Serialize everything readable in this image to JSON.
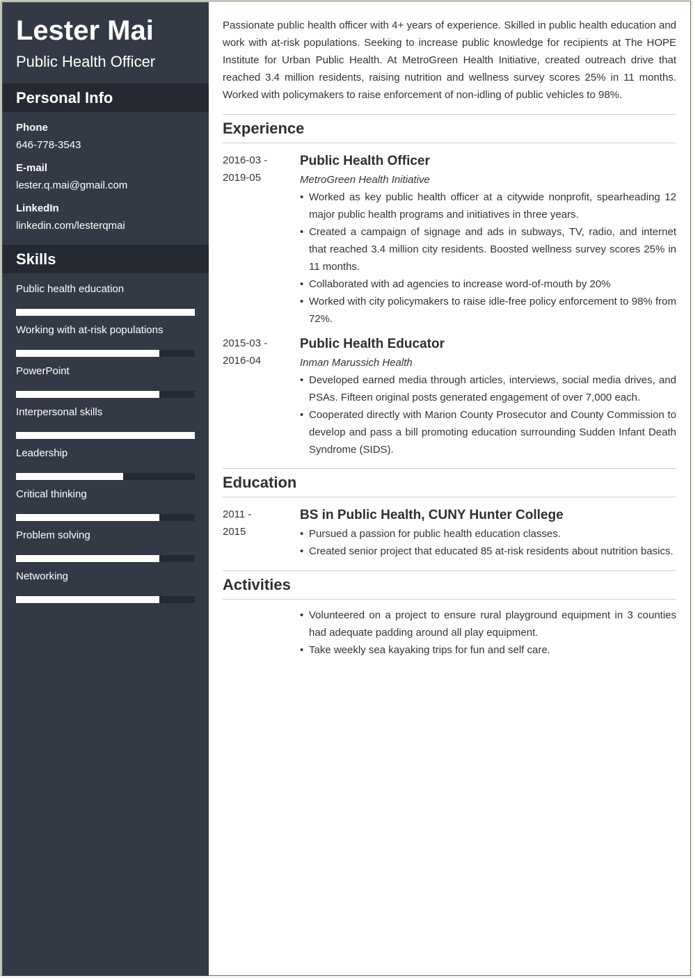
{
  "sidebar": {
    "name": "Lester Mai",
    "title": "Public Health Officer",
    "personal_heading": "Personal Info",
    "contacts": [
      {
        "label": "Phone",
        "value": "646-778-3543"
      },
      {
        "label": "E-mail",
        "value": "lester.q.mai@gmail.com"
      },
      {
        "label": "LinkedIn",
        "value": "linkedin.com/lesterqmai"
      }
    ],
    "skills_heading": "Skills",
    "skills": [
      {
        "name": "Public health education",
        "level": 1.0
      },
      {
        "name": "Working with at-risk populations",
        "level": 0.8
      },
      {
        "name": "PowerPoint",
        "level": 0.8
      },
      {
        "name": "Interpersonal skills",
        "level": 1.0
      },
      {
        "name": "Leadership",
        "level": 0.6
      },
      {
        "name": "Critical thinking",
        "level": 0.8
      },
      {
        "name": "Problem solving",
        "level": 0.8
      },
      {
        "name": "Networking",
        "level": 0.8
      }
    ]
  },
  "summary": "Passionate public health officer with 4+ years of experience. Skilled in public health education and work with at-risk populations. Seeking to increase public knowledge for recipients at The HOPE Institute for Urban Public Health. At MetroGreen Health Initiative, created outreach drive that reached 3.4 million residents, raising nutrition and wellness survey scores 25% in 11 months. Worked with policymakers to raise enforcement of non-idling of public vehicles to 98%.",
  "experience": {
    "heading": "Experience",
    "jobs": [
      {
        "start": "2016-03 -",
        "end": "2019-05",
        "title": "Public Health Officer",
        "company": "MetroGreen Health Initiative",
        "bullets": [
          "Worked as key public health officer at a citywide nonprofit, spearheading 12 major public health programs and initiatives in three years.",
          "Created a campaign of signage and ads in subways, TV, radio, and internet that reached 3.4 million city residents. Boosted wellness survey scores 25% in 11 months.",
          "Collaborated with ad agencies to increase word-of-mouth by 20%",
          "Worked with city policymakers to raise idle-free policy enforcement to 98% from 72%."
        ]
      },
      {
        "start": "2015-03 -",
        "end": "2016-04",
        "title": "Public Health Educator",
        "company": "Inman Marussich Health",
        "bullets": [
          "Developed earned media through articles, interviews, social media drives, and PSAs. Fifteen original posts generated engagement of over 7,000 each.",
          "Cooperated directly with Marion County Prosecutor and County Commission to develop and pass a bill promoting education surrounding Sudden Infant Death Syndrome (SIDS)."
        ]
      }
    ]
  },
  "education": {
    "heading": "Education",
    "start": "2011 -",
    "end": "2015",
    "degree": "BS in Public Health, CUNY Hunter College",
    "bullets": [
      "Pursued a passion for public health education classes.",
      "Created senior project that educated 85 at-risk residents about nutrition basics."
    ]
  },
  "activities": {
    "heading": "Activities",
    "bullets": [
      "Volunteered on a project to ensure rural playground equipment in 3 counties had adequate padding around all play equipment.",
      "Take weekly sea kayaking trips for fun and self care."
    ]
  }
}
